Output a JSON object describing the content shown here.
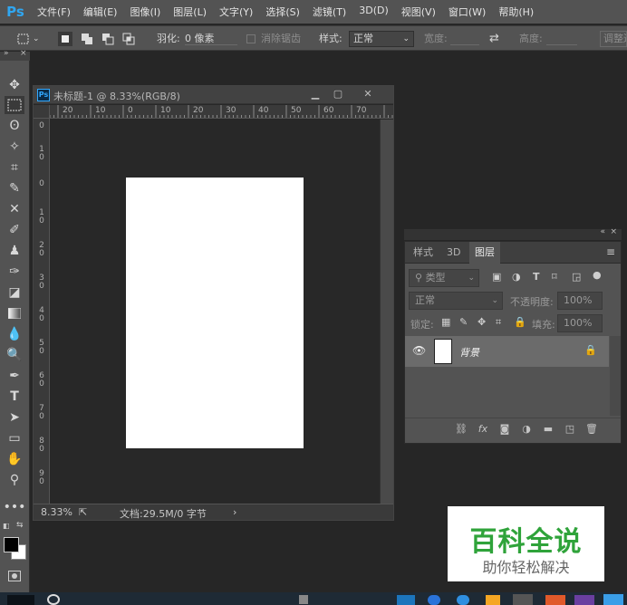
{
  "app": {
    "logo": "Ps"
  },
  "menu": [
    "文件(F)",
    "编辑(E)",
    "图像(I)",
    "图层(L)",
    "文字(Y)",
    "选择(S)",
    "滤镜(T)",
    "3D(D)",
    "视图(V)",
    "窗口(W)",
    "帮助(H)"
  ],
  "options": {
    "feather_label": "羽化:",
    "feather_value": "0 像素",
    "antialias_label": "消除锯齿",
    "style_label": "样式:",
    "style_value": "正常",
    "width_label": "宽度:",
    "height_label": "高度:",
    "refine_label": "调整边"
  },
  "document": {
    "title": "未标题-1 @ 8.33%(RGB/8)",
    "zoom": "8.33%",
    "doc_info": "文档:29.5M/0 字节",
    "hruler_labels": [
      "20",
      "10",
      "0",
      "10",
      "20",
      "30",
      "40",
      "50",
      "60",
      "70"
    ],
    "vruler_labels": [
      "0",
      "1 0",
      "0",
      "1 0",
      "2 0",
      "3 0",
      "4 0",
      "5 0",
      "6 0",
      "7 0",
      "8 0",
      "9 0"
    ]
  },
  "layers_panel": {
    "tabs": [
      "样式",
      "3D",
      "图层"
    ],
    "active_tab": "图层",
    "filter_label": "类型",
    "blend_mode": "正常",
    "opacity_label": "不透明度:",
    "opacity_value": "100%",
    "lock_label": "锁定:",
    "fill_label": "填充:",
    "fill_value": "100%",
    "layer_name": "背景"
  },
  "watermark": {
    "title": "百科全说",
    "subtitle": "助你轻松解决"
  },
  "colors": {
    "accent": "#31a8ff",
    "ui_bg": "#535353",
    "canvas_bg": "#282828",
    "watermark_green": "#2fa33a"
  }
}
